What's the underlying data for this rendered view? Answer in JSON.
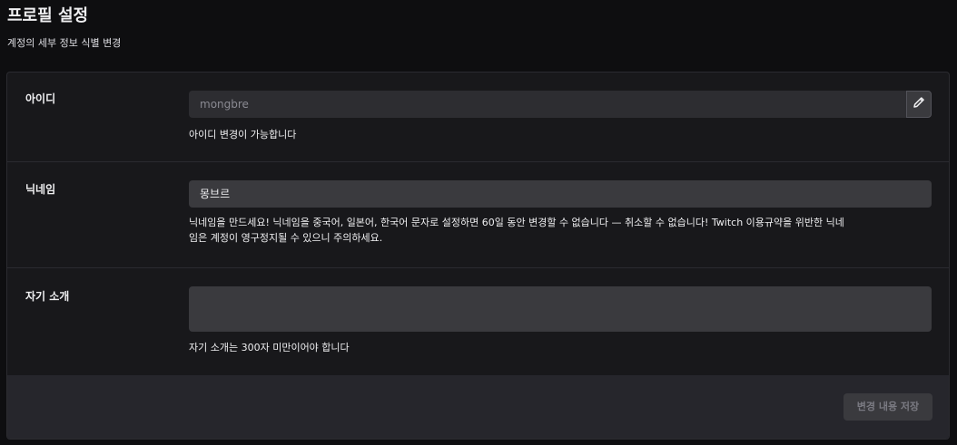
{
  "header": {
    "title": "프로필 설정",
    "subtitle": "계정의 세부 정보 식별 변경"
  },
  "rows": {
    "username": {
      "label": "아이디",
      "value": "mongbre",
      "help": "아이디 변경이 가능합니다",
      "edit_icon": "pencil-icon"
    },
    "nickname": {
      "label": "닉네임",
      "value": "몽브르",
      "help_line1": "닉네임을 만드세요! 닉네임을 중국어, 일본어, 한국어 문자로 설정하면 60일 동안 변경할 수 없습니다 — 취소할 수 없습니다! Twitch 이용규약을 위반한 닉네",
      "help_line2": "임은 계정이 영구정지될 수 있으니 주의하세요."
    },
    "bio": {
      "label": "자기 소개",
      "value": "",
      "help": "자기 소개는 300자 미만이어야 합니다"
    }
  },
  "footer": {
    "save_label": "변경 내용 저장"
  },
  "colors": {
    "background": "#0e0e10",
    "card": "#18181b",
    "input": "#3a3a3e",
    "footer": "#26262c"
  }
}
